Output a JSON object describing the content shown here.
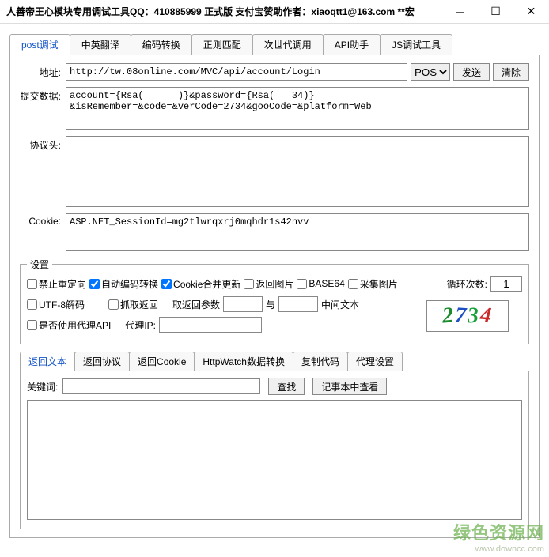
{
  "window": {
    "title": "人善帝王心模块专用调试工具QQ：410885999 正式版   支付宝赞助作者：xiaoqtt1@163.com **宏"
  },
  "tabs": {
    "items": [
      "post调试",
      "中英翻译",
      "编码转换",
      "正则匹配",
      "次世代调用",
      "API助手",
      "JS调试工具"
    ],
    "activeIndex": 0
  },
  "url": {
    "label": "地址:",
    "value": "http://tw.08online.com/MVC/api/account/Login",
    "method": "POST",
    "send": "发送",
    "clear": "清除"
  },
  "submit": {
    "label": "提交数据:",
    "value": "account={Rsa(      )}&password={Rsa(   34)}\n&isRemember=&code=&verCode=2734&gooCode=&platform=Web"
  },
  "protoHeader": {
    "label": "协议头:",
    "value": ""
  },
  "cookie": {
    "label": "Cookie:",
    "value": "ASP.NET_SessionId=mg2tlwrqxrj0mqhdr1s42nvv"
  },
  "settings": {
    "legend": "设置",
    "noRedirect": "禁止重定向",
    "autoEncode": "自动编码转换",
    "cookieMerge": "Cookie合并更新",
    "retImage": "返回图片",
    "base64": "BASE64",
    "collectImage": "采集图片",
    "loopLabel": "循环次数:",
    "loopValue": "1",
    "utf8": "UTF-8解码",
    "grab": "抓取返回",
    "retParamLabel": "取返回参数",
    "retParam1": "",
    "and": "与",
    "retParam2": "",
    "midText": "中间文本",
    "useProxy": "是否使用代理API",
    "proxyIpLabel": "代理IP:",
    "proxyIpValue": "",
    "captcha": "2734",
    "checks": {
      "noRedirect": false,
      "autoEncode": true,
      "cookieMerge": true,
      "retImage": false,
      "base64": false,
      "collectImage": false,
      "utf8": false,
      "grab": false,
      "useProxy": false
    }
  },
  "subtabs": {
    "items": [
      "返回文本",
      "返回协议",
      "返回Cookie",
      "HttpWatch数据转换",
      "复制代码",
      "代理设置"
    ],
    "activeIndex": 0
  },
  "response": {
    "kwLabel": "关键词:",
    "kwValue": "",
    "find": "查找",
    "notepad": "记事本中查看",
    "body": ""
  },
  "watermark": {
    "big": "绿色资源网",
    "small": "www.downcc.com"
  }
}
